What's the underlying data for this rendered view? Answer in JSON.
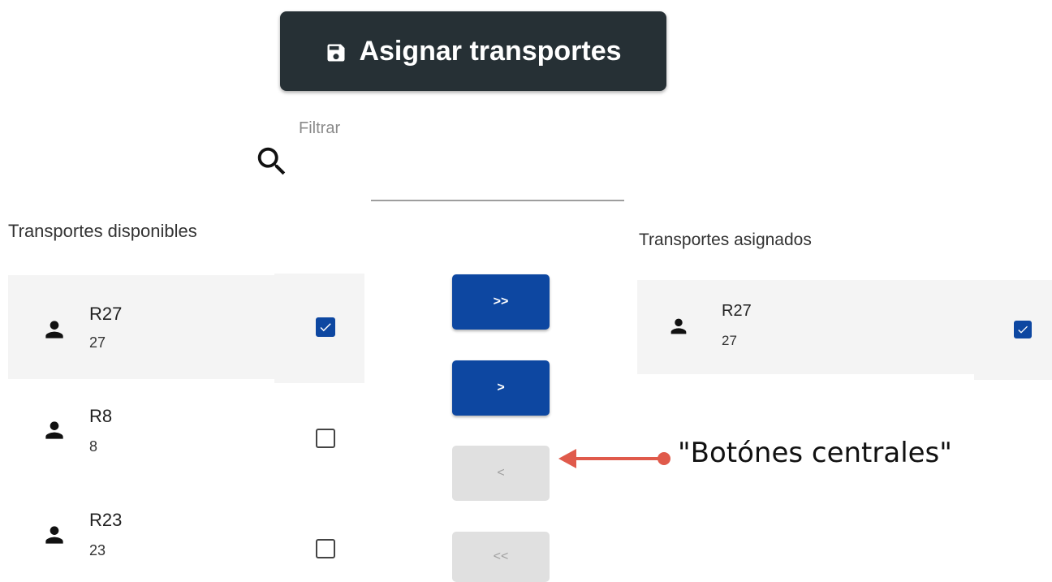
{
  "toolbar": {
    "save_label": "Asignar transportes",
    "save_icon": "floppy-disk-icon"
  },
  "filter": {
    "label": "Filtrar",
    "value": "",
    "icon": "search-icon"
  },
  "available": {
    "title": "Transportes disponibles",
    "items": [
      {
        "name": "R27",
        "code": "27",
        "checked": true,
        "highlighted": true
      },
      {
        "name": "R8",
        "code": "8",
        "checked": false,
        "highlighted": false
      },
      {
        "name": "R23",
        "code": "23",
        "checked": false,
        "highlighted": false
      }
    ]
  },
  "assigned": {
    "title": "Transportes asignados",
    "items": [
      {
        "name": "R27",
        "code": "27",
        "checked": true,
        "highlighted": true
      }
    ]
  },
  "center_buttons": {
    "move_all_right": ">>",
    "move_right": ">",
    "move_left": "<",
    "move_all_left": "<<"
  },
  "annotation": {
    "text": "\"Botónes centrales\""
  },
  "colors": {
    "primary": "#0d47a1",
    "dark": "#263035",
    "annotation": "#e05a4b",
    "row_highlight": "#f4f4f4"
  }
}
